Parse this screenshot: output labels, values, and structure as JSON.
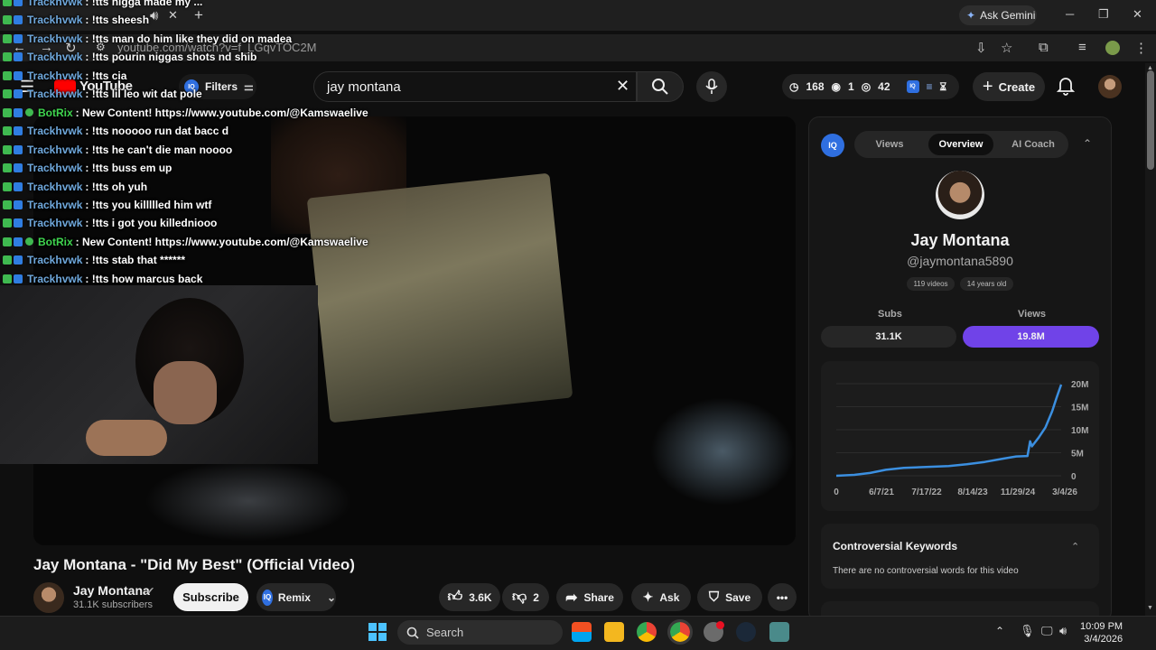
{
  "browser": {
    "url": "youtube.com/watch?v=f_LGqvTOC2M",
    "gemini_label": "Ask Gemini",
    "new_tab": "+",
    "minimize": "─",
    "maximize": "❐",
    "close": "✕"
  },
  "youtube": {
    "logo_text": "YouTube",
    "filters_label": "Filters",
    "search_value": "jay montana",
    "stats": {
      "time": "168",
      "live": "1",
      "views": "42"
    },
    "create_label": "Create"
  },
  "chat": [
    {
      "user": "Trackhvwk",
      "msg": ": !tts nigga made my ...",
      "color": "#6fa8dc",
      "bot": false
    },
    {
      "user": "Trackhvwk",
      "msg": ": !tts sheesh",
      "color": "#6fa8dc",
      "bot": false
    },
    {
      "user": "Trackhvwk",
      "msg": ": !tts man do him like they did on madea",
      "color": "#6fa8dc",
      "bot": false
    },
    {
      "user": "Trackhvwk",
      "msg": ": !tts pourin niggas shots nd shib",
      "color": "#6fa8dc",
      "bot": false
    },
    {
      "user": "Trackhvwk",
      "msg": ": !tts cia",
      "color": "#6fa8dc",
      "bot": false
    },
    {
      "user": "Trackhvwk",
      "msg": ": !tts lil leo wit dat pole",
      "color": "#6fa8dc",
      "bot": false
    },
    {
      "user": "BotRix",
      "msg": ": New Content! https://www.youtube.com/@Kamswaelive",
      "color": "#3fd64f",
      "bot": true
    },
    {
      "user": "Trackhvwk",
      "msg": ": !tts nooooo run dat bacc d",
      "color": "#6fa8dc",
      "bot": false
    },
    {
      "user": "Trackhvwk",
      "msg": ": !tts he can't die man noooo",
      "color": "#6fa8dc",
      "bot": false
    },
    {
      "user": "Trackhvwk",
      "msg": ": !tts buss em up",
      "color": "#6fa8dc",
      "bot": false
    },
    {
      "user": "Trackhvwk",
      "msg": ": !tts oh yuh",
      "color": "#6fa8dc",
      "bot": false
    },
    {
      "user": "Trackhvwk",
      "msg": ": !tts you killllled him wtf",
      "color": "#6fa8dc",
      "bot": false
    },
    {
      "user": "Trackhvwk",
      "msg": ": !tts i got you killedniooo",
      "color": "#6fa8dc",
      "bot": false
    },
    {
      "user": "BotRix",
      "msg": ": New Content! https://www.youtube.com/@Kamswaelive",
      "color": "#3fd64f",
      "bot": true
    },
    {
      "user": "Trackhvwk",
      "msg": ": !tts stab that ******",
      "color": "#6fa8dc",
      "bot": false
    },
    {
      "user": "Trackhvwk",
      "msg": ": !tts how marcus back",
      "color": "#6fa8dc",
      "bot": false
    }
  ],
  "video": {
    "title": "Jay Montana - \"Did My Best\" (Official Video)",
    "channel_name": "Jay Montana",
    "channel_subs": "31.1K subscribers",
    "subscribe_label": "Subscribe",
    "remix_label": "Remix",
    "likes": "3.6K",
    "dislikes": "2",
    "share_label": "Share",
    "ask_label": "Ask",
    "save_label": "Save"
  },
  "panel": {
    "logo": "IQ",
    "tabs": [
      "Views",
      "Overview",
      "AI Coach"
    ],
    "active_tab": "Overview",
    "name": "Jay Montana",
    "handle": "@jaymontana5890",
    "chips": [
      "119 videos",
      "14 years old"
    ],
    "subs_label": "Subs",
    "views_label": "Views",
    "subs_value": "31.1K",
    "views_value": "19.8M",
    "keywords_title": "Controversial Keywords",
    "keywords_text": "There are no controversial words for this video",
    "accent": "#7043e8"
  },
  "chart_data": {
    "type": "line",
    "x_ticks": [
      "0",
      "6/7/21",
      "7/17/22",
      "8/14/23",
      "11/29/24",
      "3/4/26"
    ],
    "y_ticks": [
      "0",
      "5M",
      "10M",
      "15M",
      "20M"
    ],
    "ylim": [
      0,
      20000000
    ],
    "x": [
      0,
      0.08,
      0.15,
      0.22,
      0.3,
      0.4,
      0.5,
      0.58,
      0.66,
      0.74,
      0.8,
      0.85,
      0.862,
      0.87,
      0.9,
      0.93,
      0.96,
      0.98,
      1.0
    ],
    "values": [
      0,
      200000,
      600000,
      1300000,
      1700000,
      1900000,
      2100000,
      2500000,
      3000000,
      3700000,
      4200000,
      4300000,
      7500000,
      6400000,
      8300000,
      10500000,
      14000000,
      17000000,
      19800000
    ],
    "color": "#3b8fe0"
  },
  "taskbar": {
    "search_label": "Search",
    "time": "10:09 PM",
    "date": "3/4/2026"
  }
}
